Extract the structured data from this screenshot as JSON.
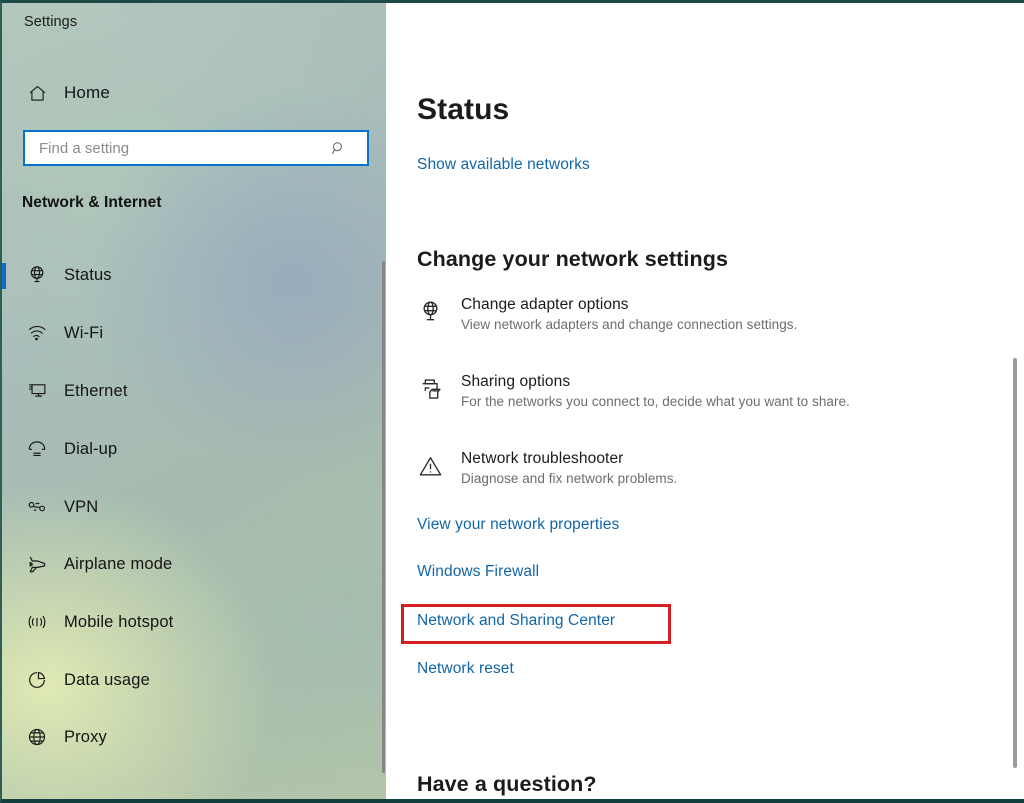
{
  "window": {
    "title": "Settings",
    "controls": [
      {
        "name": "minimize",
        "glyph": "─"
      },
      {
        "name": "maximize",
        "glyph": "□"
      },
      {
        "name": "close",
        "glyph": "✕"
      }
    ]
  },
  "sidebar": {
    "home_label": "Home",
    "home_icon": "home-icon",
    "search": {
      "placeholder": "Find a setting",
      "value": "",
      "icon": "search-icon"
    },
    "category_title": "Network & Internet",
    "items": [
      {
        "label": "Status",
        "icon": "globe-status-icon",
        "selected": true
      },
      {
        "label": "Wi-Fi",
        "icon": "wifi-icon",
        "selected": false
      },
      {
        "label": "Ethernet",
        "icon": "ethernet-icon",
        "selected": false
      },
      {
        "label": "Dial-up",
        "icon": "dialup-phone-icon",
        "selected": false
      },
      {
        "label": "VPN",
        "icon": "vpn-icon",
        "selected": false
      },
      {
        "label": "Airplane mode",
        "icon": "airplane-icon",
        "selected": false
      },
      {
        "label": "Mobile hotspot",
        "icon": "hotspot-icon",
        "selected": false
      },
      {
        "label": "Data usage",
        "icon": "pie-chart-icon",
        "selected": false
      },
      {
        "label": "Proxy",
        "icon": "globe-proxy-icon",
        "selected": false
      }
    ]
  },
  "main": {
    "page_title": "Status",
    "show_networks_link": "Show available networks",
    "section_heading": "Change your network settings",
    "settings": [
      {
        "title": "Change adapter options",
        "description": "View network adapters and change connection settings.",
        "icon": "adapter-globe-monitor-icon"
      },
      {
        "title": "Sharing options",
        "description": "For the networks you connect to, decide what you want to share.",
        "icon": "sharing-printer-folder-icon"
      },
      {
        "title": "Network troubleshooter",
        "description": "Diagnose and fix network problems.",
        "icon": "warning-triangle-icon"
      }
    ],
    "links": [
      {
        "label": "View your network properties",
        "highlighted": false
      },
      {
        "label": "Windows Firewall",
        "highlighted": false
      },
      {
        "label": "Network and Sharing Center",
        "highlighted": true
      },
      {
        "label": "Network reset",
        "highlighted": false
      }
    ],
    "question_heading": "Have a question?"
  },
  "colors": {
    "accent": "#0078d7",
    "link": "#1266a8",
    "highlight_border": "#d21e1e",
    "text": "#1b1b1b",
    "muted_text": "#6d6d6d"
  }
}
